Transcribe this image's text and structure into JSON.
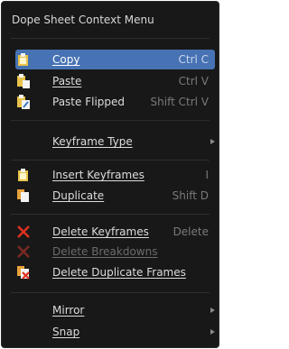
{
  "menu": {
    "title": "Dope Sheet Context Menu",
    "items": [
      {
        "label": "Copy",
        "shortcut": "Ctrl C",
        "icon": "copy-icon",
        "active": true
      },
      {
        "label": "Paste",
        "shortcut": "Ctrl V",
        "icon": "paste-icon"
      },
      {
        "label": "Paste Flipped",
        "shortcut": "Shift Ctrl V",
        "icon": "paste-flipped-icon"
      },
      {
        "label": "Keyframe Type",
        "submenu": true
      },
      {
        "label": "Insert Keyframes",
        "shortcut": "I",
        "icon": "insert-keyframes-icon"
      },
      {
        "label": "Duplicate",
        "shortcut": "Shift D",
        "icon": "duplicate-icon"
      },
      {
        "label": "Delete Keyframes",
        "shortcut": "Delete",
        "icon": "delete-x-icon"
      },
      {
        "label": "Delete Breakdowns",
        "icon": "delete-x-icon",
        "disabled": true
      },
      {
        "label": "Delete Duplicate Frames",
        "icon": "delete-duplicate-icon"
      },
      {
        "label": "Mirror",
        "submenu": true
      },
      {
        "label": "Snap",
        "submenu": true
      }
    ]
  },
  "colors": {
    "background": "#181818",
    "highlight": "#4772b3",
    "delete_icon": "#e0311e",
    "disabled_icon": "#7a2a24"
  }
}
